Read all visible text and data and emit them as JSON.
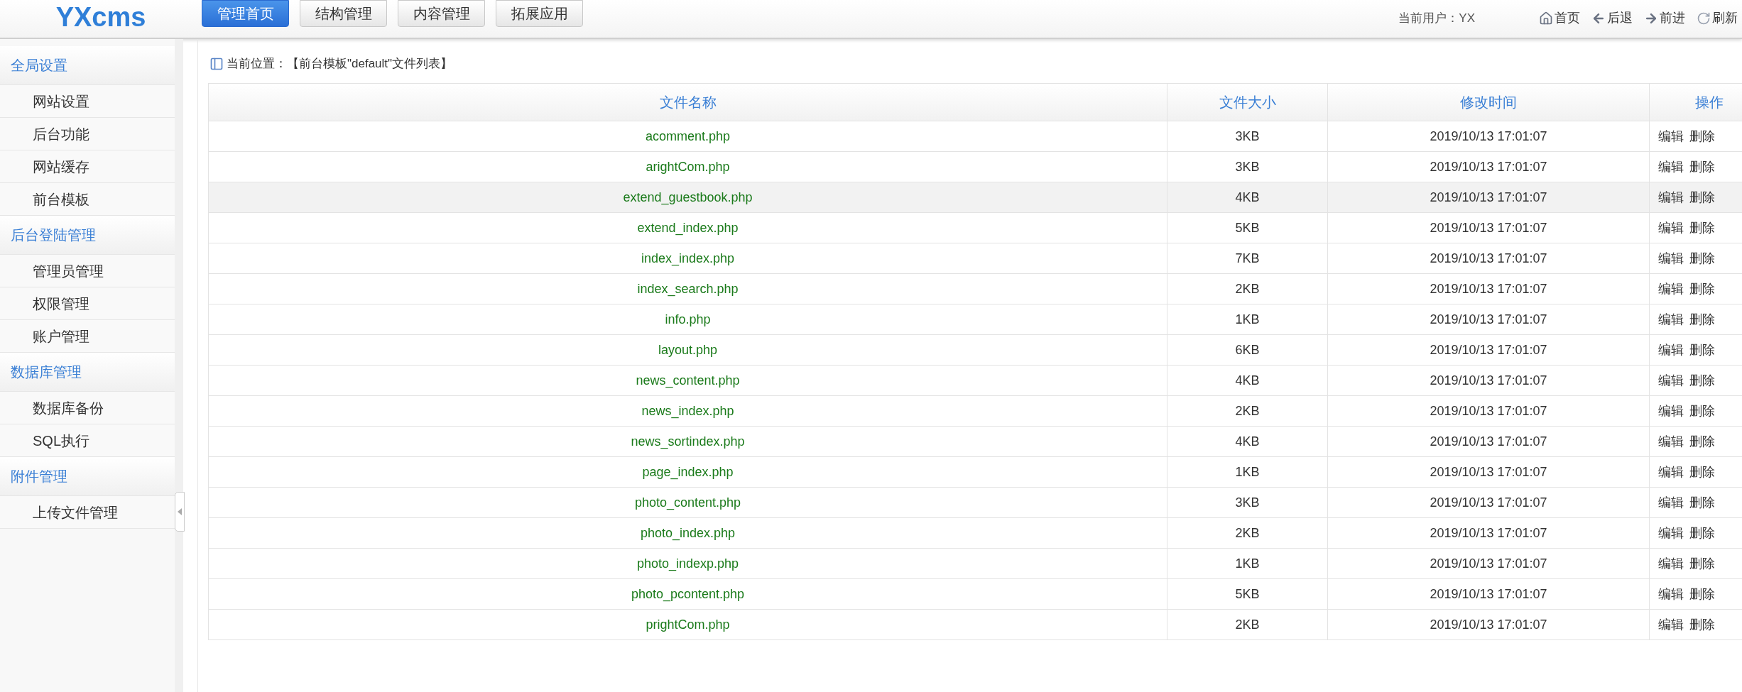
{
  "header": {
    "logo": "YXcms",
    "nav": [
      {
        "label": "管理首页",
        "selected": true
      },
      {
        "label": "结构管理",
        "selected": false
      },
      {
        "label": "内容管理",
        "selected": false
      },
      {
        "label": "拓展应用",
        "selected": false
      }
    ],
    "current_user": "当前用户：YX",
    "links": [
      {
        "kind": "home",
        "label": "首页"
      },
      {
        "kind": "back",
        "label": "后退"
      },
      {
        "kind": "forward",
        "label": "前进"
      },
      {
        "kind": "refresh",
        "label": "刷新"
      }
    ]
  },
  "sidebar": {
    "groups": [
      {
        "title": "全局设置",
        "children": [
          "网站设置",
          "后台功能",
          "网站缓存",
          "前台模板"
        ]
      },
      {
        "title": "后台登陆管理",
        "children": [
          "管理员管理",
          "权限管理",
          "账户管理"
        ]
      },
      {
        "title": "数据库管理",
        "children": [
          "数据库备份",
          "SQL执行"
        ]
      },
      {
        "title": "附件管理",
        "children": [
          "上传文件管理"
        ]
      }
    ]
  },
  "breadcrumb": "当前位置：【前台模板\"default\"文件列表】",
  "table": {
    "columns": [
      "文件名称",
      "文件大小",
      "修改时间",
      "操作"
    ],
    "rows": [
      {
        "name": "acomment.php",
        "size": "3KB",
        "time": "2019/10/13 17:01:07",
        "actions": [
          "编辑",
          "删除"
        ],
        "highlighted": false
      },
      {
        "name": "arightCom.php",
        "size": "3KB",
        "time": "2019/10/13 17:01:07",
        "actions": [
          "编辑",
          "删除"
        ],
        "highlighted": false
      },
      {
        "name": "extend_guestbook.php",
        "size": "4KB",
        "time": "2019/10/13 17:01:07",
        "actions": [
          "编辑",
          "删除"
        ],
        "highlighted": true
      },
      {
        "name": "extend_index.php",
        "size": "5KB",
        "time": "2019/10/13 17:01:07",
        "actions": [
          "编辑",
          "删除"
        ],
        "highlighted": false
      },
      {
        "name": "index_index.php",
        "size": "7KB",
        "time": "2019/10/13 17:01:07",
        "actions": [
          "编辑",
          "删除"
        ],
        "highlighted": false
      },
      {
        "name": "index_search.php",
        "size": "2KB",
        "time": "2019/10/13 17:01:07",
        "actions": [
          "编辑",
          "删除"
        ],
        "highlighted": false
      },
      {
        "name": "info.php",
        "size": "1KB",
        "time": "2019/10/13 17:01:07",
        "actions": [
          "编辑",
          "删除"
        ],
        "highlighted": false
      },
      {
        "name": "layout.php",
        "size": "6KB",
        "time": "2019/10/13 17:01:07",
        "actions": [
          "编辑",
          "删除"
        ],
        "highlighted": false
      },
      {
        "name": "news_content.php",
        "size": "4KB",
        "time": "2019/10/13 17:01:07",
        "actions": [
          "编辑",
          "删除"
        ],
        "highlighted": false
      },
      {
        "name": "news_index.php",
        "size": "2KB",
        "time": "2019/10/13 17:01:07",
        "actions": [
          "编辑",
          "删除"
        ],
        "highlighted": false
      },
      {
        "name": "news_sortindex.php",
        "size": "4KB",
        "time": "2019/10/13 17:01:07",
        "actions": [
          "编辑",
          "删除"
        ],
        "highlighted": false
      },
      {
        "name": "page_index.php",
        "size": "1KB",
        "time": "2019/10/13 17:01:07",
        "actions": [
          "编辑",
          "删除"
        ],
        "highlighted": false
      },
      {
        "name": "photo_content.php",
        "size": "3KB",
        "time": "2019/10/13 17:01:07",
        "actions": [
          "编辑",
          "删除"
        ],
        "highlighted": false
      },
      {
        "name": "photo_index.php",
        "size": "2KB",
        "time": "2019/10/13 17:01:07",
        "actions": [
          "编辑",
          "删除"
        ],
        "highlighted": false
      },
      {
        "name": "photo_indexp.php",
        "size": "1KB",
        "time": "2019/10/13 17:01:07",
        "actions": [
          "编辑",
          "删除"
        ],
        "highlighted": false
      },
      {
        "name": "photo_pcontent.php",
        "size": "5KB",
        "time": "2019/10/13 17:01:07",
        "actions": [
          "编辑",
          "删除"
        ],
        "highlighted": false
      },
      {
        "name": "prightCom.php",
        "size": "2KB",
        "time": "2019/10/13 17:01:07",
        "actions": [
          "编辑",
          "删除"
        ],
        "highlighted": false
      }
    ]
  }
}
